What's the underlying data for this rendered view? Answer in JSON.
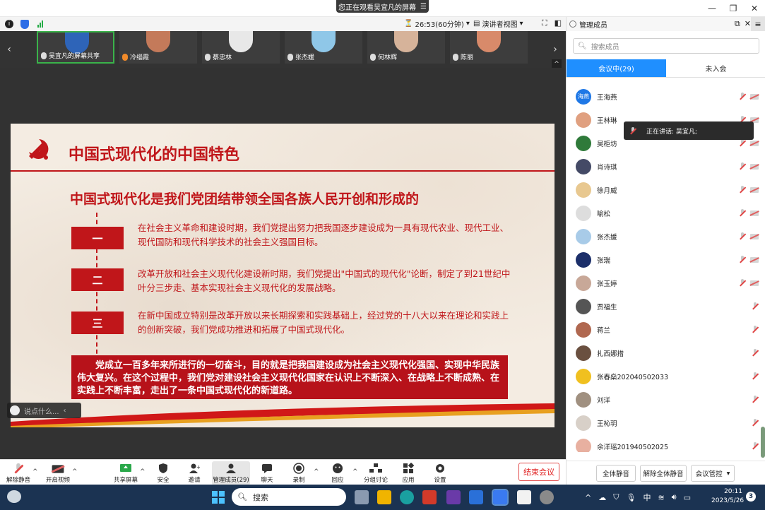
{
  "top": {
    "watching": "您正在观看吴宜凡的屏幕",
    "watching_menu": "☰"
  },
  "infobar": {
    "timer": "26:53(60分钟)",
    "view": "演讲者视图"
  },
  "thumbnails": [
    {
      "name": "吴宜凡的屏幕共享",
      "color": "#2e64b8"
    },
    {
      "name": "冷缁霞",
      "color": "#c47a5a"
    },
    {
      "name": "蔡忠林",
      "color": "#e8e8e8"
    },
    {
      "name": "张杰媛",
      "color": "#8fc7e8"
    },
    {
      "name": "何林辉",
      "color": "#d6b39a"
    },
    {
      "name": "陈丽",
      "color": "#d88a6a"
    }
  ],
  "slide": {
    "title": "中国式现代化的中国特色",
    "subtitle": "中国式现代化是我们党团结带领全国各族人民开创和形成的",
    "items": [
      {
        "num": "一",
        "text": "在社会主义革命和建设时期，我们党提出努力把我国逐步建设成为一具有现代农业、现代工业、现代国防和现代科学技术的社会主义强国目标。"
      },
      {
        "num": "二",
        "text": "改革开放和社会主义现代化建设新时期，我们党提出\"中国式的现代化\"论断，制定了到21世纪中叶分三步走、基本实现社会主义现代化的发展战略。"
      },
      {
        "num": "三",
        "text": "在新中国成立特别是改革开放以来长期探索和实践基础上，经过党的十八大以来在理论和实践上的创新突破，我们党成功推进和拓展了中国式现代化。"
      }
    ],
    "summary": "党成立一百多年来所进行的一切奋斗，目的就是把我国建设成为社会主义现代化强国、实现中华民族伟大复兴。在这个过程中，我们党对建设社会主义现代化国家在认识上不断深入、在战略上不断成熟、在实践上不断丰富，走出了一条中国式现代化的新道路。"
  },
  "chat": {
    "placeholder": "说点什么..."
  },
  "toolbar": {
    "unmute": "解除静音",
    "video": "开启视频",
    "share": "共享屏幕",
    "security": "安全",
    "invite": "邀请",
    "members": "管理成员(29)",
    "chat": "聊天",
    "record": "录制",
    "reactions": "回应",
    "breakout": "分组讨论",
    "apps": "应用",
    "settings": "设置",
    "end": "结束会议"
  },
  "panel": {
    "title": "管理成员",
    "search_placeholder": "搜索成员",
    "tab_in": "会议中(29)",
    "tab_out": "未入会",
    "speaking": "正在讲话: 吴宜凡;",
    "members": [
      {
        "name": "王海燕",
        "color": "#1f78e6",
        "label": "海燕",
        "cam": true
      },
      {
        "name": "王林琳",
        "color": "#e0a080",
        "label": "",
        "cam": true
      },
      {
        "name": "吴柜坊",
        "color": "#2f7a3a",
        "label": "",
        "cam": true
      },
      {
        "name": "肖诗琪",
        "color": "#444a66",
        "label": "",
        "cam": true
      },
      {
        "name": "徐月威",
        "color": "#e8c890",
        "label": "",
        "cam": true
      },
      {
        "name": "喻松",
        "color": "#dddddd",
        "label": "",
        "cam": true
      },
      {
        "name": "张杰媛",
        "color": "#a8cbe8",
        "label": "",
        "cam": true
      },
      {
        "name": "张瑞",
        "color": "#1c2f6a",
        "label": "",
        "cam": true
      },
      {
        "name": "张玉婷",
        "color": "#c8a898",
        "label": "",
        "cam": true
      },
      {
        "name": "贾福生",
        "color": "#555555",
        "label": "",
        "cam": false
      },
      {
        "name": "蒋兰",
        "color": "#b06850",
        "label": "",
        "cam": false
      },
      {
        "name": "扎西娜措",
        "color": "#6a5040",
        "label": "",
        "cam": false
      },
      {
        "name": "张春燊202040502033",
        "color": "#f0c020",
        "label": "",
        "cam": false
      },
      {
        "name": "刘洋",
        "color": "#a09080",
        "label": "",
        "cam": false
      },
      {
        "name": "王杺玥",
        "color": "#d8d0c8",
        "label": "",
        "cam": false
      },
      {
        "name": "余洋瑶201940502025",
        "color": "#e8b0a0",
        "label": "",
        "cam": false
      }
    ],
    "btn_mute_all": "全体静音",
    "btn_unmute_all": "解除全体静音",
    "btn_control": "会议管控"
  },
  "taskbar": {
    "search": "搜索",
    "ime": "中",
    "time": "20:11",
    "date": "2023/5/26",
    "badge": "3"
  }
}
